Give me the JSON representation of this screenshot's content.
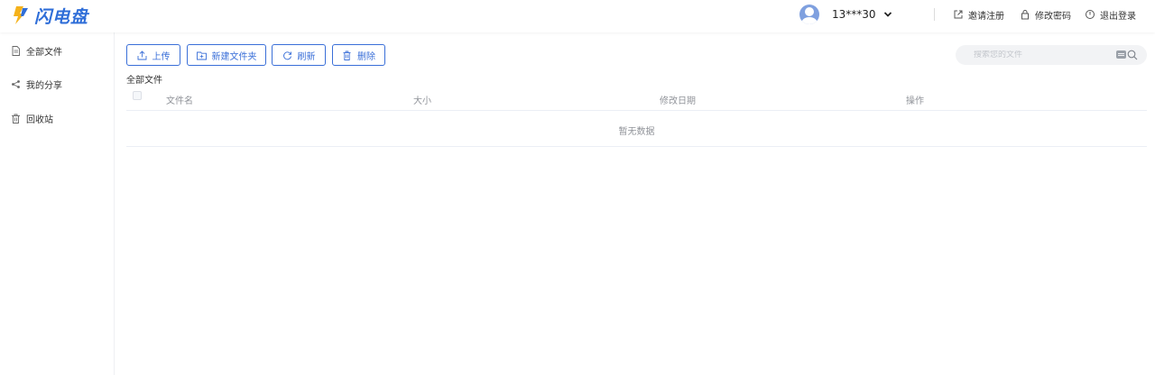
{
  "app": {
    "logo_text": "闪电盘",
    "brand_color": "#2f6ed8",
    "logo_accent": "#f5b21b"
  },
  "header": {
    "username": "13***30",
    "links": {
      "invite": "邀请注册",
      "change_password": "修改密码",
      "logout": "退出登录"
    }
  },
  "sidebar": {
    "items": [
      {
        "label": "全部文件",
        "icon": "file-icon"
      },
      {
        "label": "我的分享",
        "icon": "share-icon"
      },
      {
        "label": "回收站",
        "icon": "trash-icon"
      }
    ]
  },
  "toolbar": {
    "upload_label": "上传",
    "new_folder_label": "新建文件夹",
    "refresh_label": "刷新",
    "delete_label": "删除"
  },
  "search": {
    "placeholder": "搜索您的文件",
    "value": ""
  },
  "breadcrumb": "全部文件",
  "table": {
    "columns": [
      "文件名",
      "大小",
      "修改日期",
      "操作"
    ],
    "rows": [],
    "empty_text": "暂无数据"
  }
}
